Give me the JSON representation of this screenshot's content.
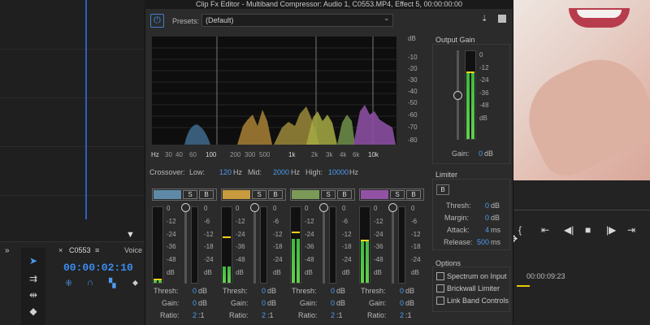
{
  "window": {
    "title": "Clip Fx Editor - Multiband Compressor: Audio 1, C0553.MP4, Effect 5, 00:00:00:00"
  },
  "presets": {
    "label": "Presets:",
    "value": "(Default)"
  },
  "spectrum": {
    "db_ticks": [
      "dB",
      "-10",
      "-20",
      "-30",
      "-40",
      "-50",
      "-60",
      "-70",
      "-80"
    ],
    "hz_ticks": [
      "Hz",
      "30",
      "40",
      "60",
      "100",
      "200",
      "300",
      "500",
      "1k",
      "2k",
      "3k",
      "4k",
      "6k",
      "10k"
    ]
  },
  "crossover": {
    "label": "Crossover:",
    "low_label": "Low:",
    "low": "120",
    "mid_label": "Mid:",
    "mid": "2000",
    "high_label": "High:",
    "high": "10000",
    "unit": "Hz"
  },
  "band_labels": {
    "solo": "S",
    "bypass": "B",
    "thresh": "Thresh:",
    "gain": "Gain:",
    "ratio": "Ratio:"
  },
  "meter_scale": [
    "0",
    "-12",
    "-24",
    "-36",
    "-48",
    "dB"
  ],
  "gr_scale": [
    "0",
    "-6",
    "-12",
    "-18",
    "-24",
    "dB"
  ],
  "bands": [
    {
      "color": "#5e8aa8",
      "thresh": "0",
      "thresh_unit": "dB",
      "gain": "0",
      "gain_unit": "dB",
      "ratio": "2",
      "ratio_unit": ":1",
      "level": 0.03,
      "peak": 0.03
    },
    {
      "color": "#c79b3e",
      "thresh": "0",
      "thresh_unit": "dB",
      "gain": "0",
      "gain_unit": "dB",
      "ratio": "2",
      "ratio_unit": ":1",
      "level": 0.22,
      "peak": 0.59
    },
    {
      "color": "#7b9a58",
      "thresh": "0",
      "thresh_unit": "dB",
      "gain": "0",
      "gain_unit": "dB",
      "ratio": "2",
      "ratio_unit": ":1",
      "level": 0.58,
      "peak": 0.66
    },
    {
      "color": "#9152a5",
      "thresh": "0",
      "thresh_unit": "dB",
      "gain": "0",
      "gain_unit": "dB",
      "ratio": "2",
      "ratio_unit": ":1",
      "level": 0.55,
      "peak": 0.55
    }
  ],
  "output_gain": {
    "title": "Output Gain",
    "scale": [
      "0",
      "-12",
      "-24",
      "-36",
      "-48",
      "dB"
    ],
    "label": "Gain:",
    "value": "0",
    "unit": "dB",
    "level": 0.75
  },
  "limiter": {
    "title": "Limiter",
    "bypass": "B",
    "thresh_label": "Thresh:",
    "thresh": "0",
    "thresh_unit": "dB",
    "margin_label": "Margin:",
    "margin": "0",
    "margin_unit": "dB",
    "attack_label": "Attack:",
    "attack": "4",
    "attack_unit": "ms",
    "release_label": "Release:",
    "release": "500",
    "release_unit": "ms"
  },
  "options": {
    "title": "Options",
    "items": [
      "Spectrum on Input",
      "Brickwall Limiter",
      "Link Band Controls"
    ]
  },
  "background": {
    "sequence_tab": "C0553",
    "timecode": "00:00:02:10",
    "voice_label": "Voice S",
    "right_timecode": "00:00:09:23"
  }
}
